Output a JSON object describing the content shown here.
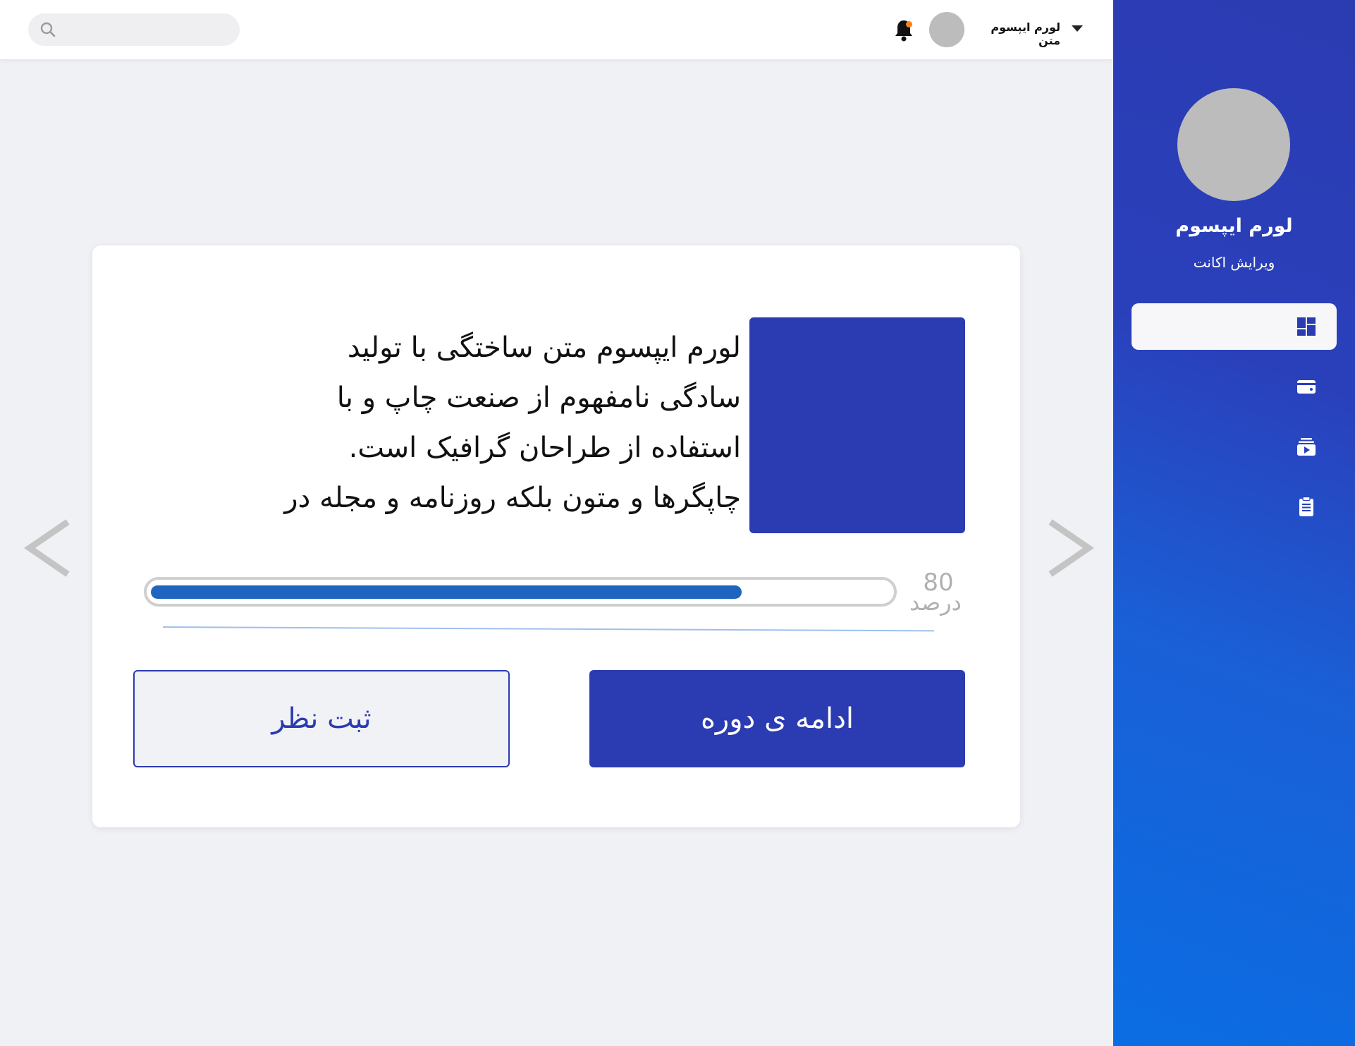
{
  "header": {
    "search_placeholder": "",
    "user_name": "لورم ایپسوم متن",
    "notification_dot_color": "#f7811f"
  },
  "sidebar": {
    "user_name": "لورم ایپسوم",
    "edit_account_label": "ویرایش اکانت",
    "background_color": "#2b3bb2",
    "items": [
      {
        "icon": "dashboard-icon",
        "active": true
      },
      {
        "icon": "wallet-icon",
        "active": false
      },
      {
        "icon": "video-library-icon",
        "active": false
      },
      {
        "icon": "clipboard-icon",
        "active": false
      }
    ]
  },
  "course_card": {
    "description_lines": [
      "لورم ایپسوم متن ساختگی با تولید",
      "سادگی نامفهوم از صنعت چاپ و با",
      "استفاده از طراحان گرافیک است.",
      "چاپگرها و متون بلکه روزنامه و مجله در"
    ],
    "progress_percent": 80,
    "progress_value_label": "80",
    "progress_unit_label": "درصد",
    "review_button_label": "ثبت نظر",
    "continue_button_label": "ادامه ی دوره",
    "accent_color": "#2b3bb2",
    "progress_color": "#1e65c0"
  },
  "carousel": {
    "prev_icon": "chevron-left-icon",
    "next_icon": "chevron-right-icon"
  }
}
